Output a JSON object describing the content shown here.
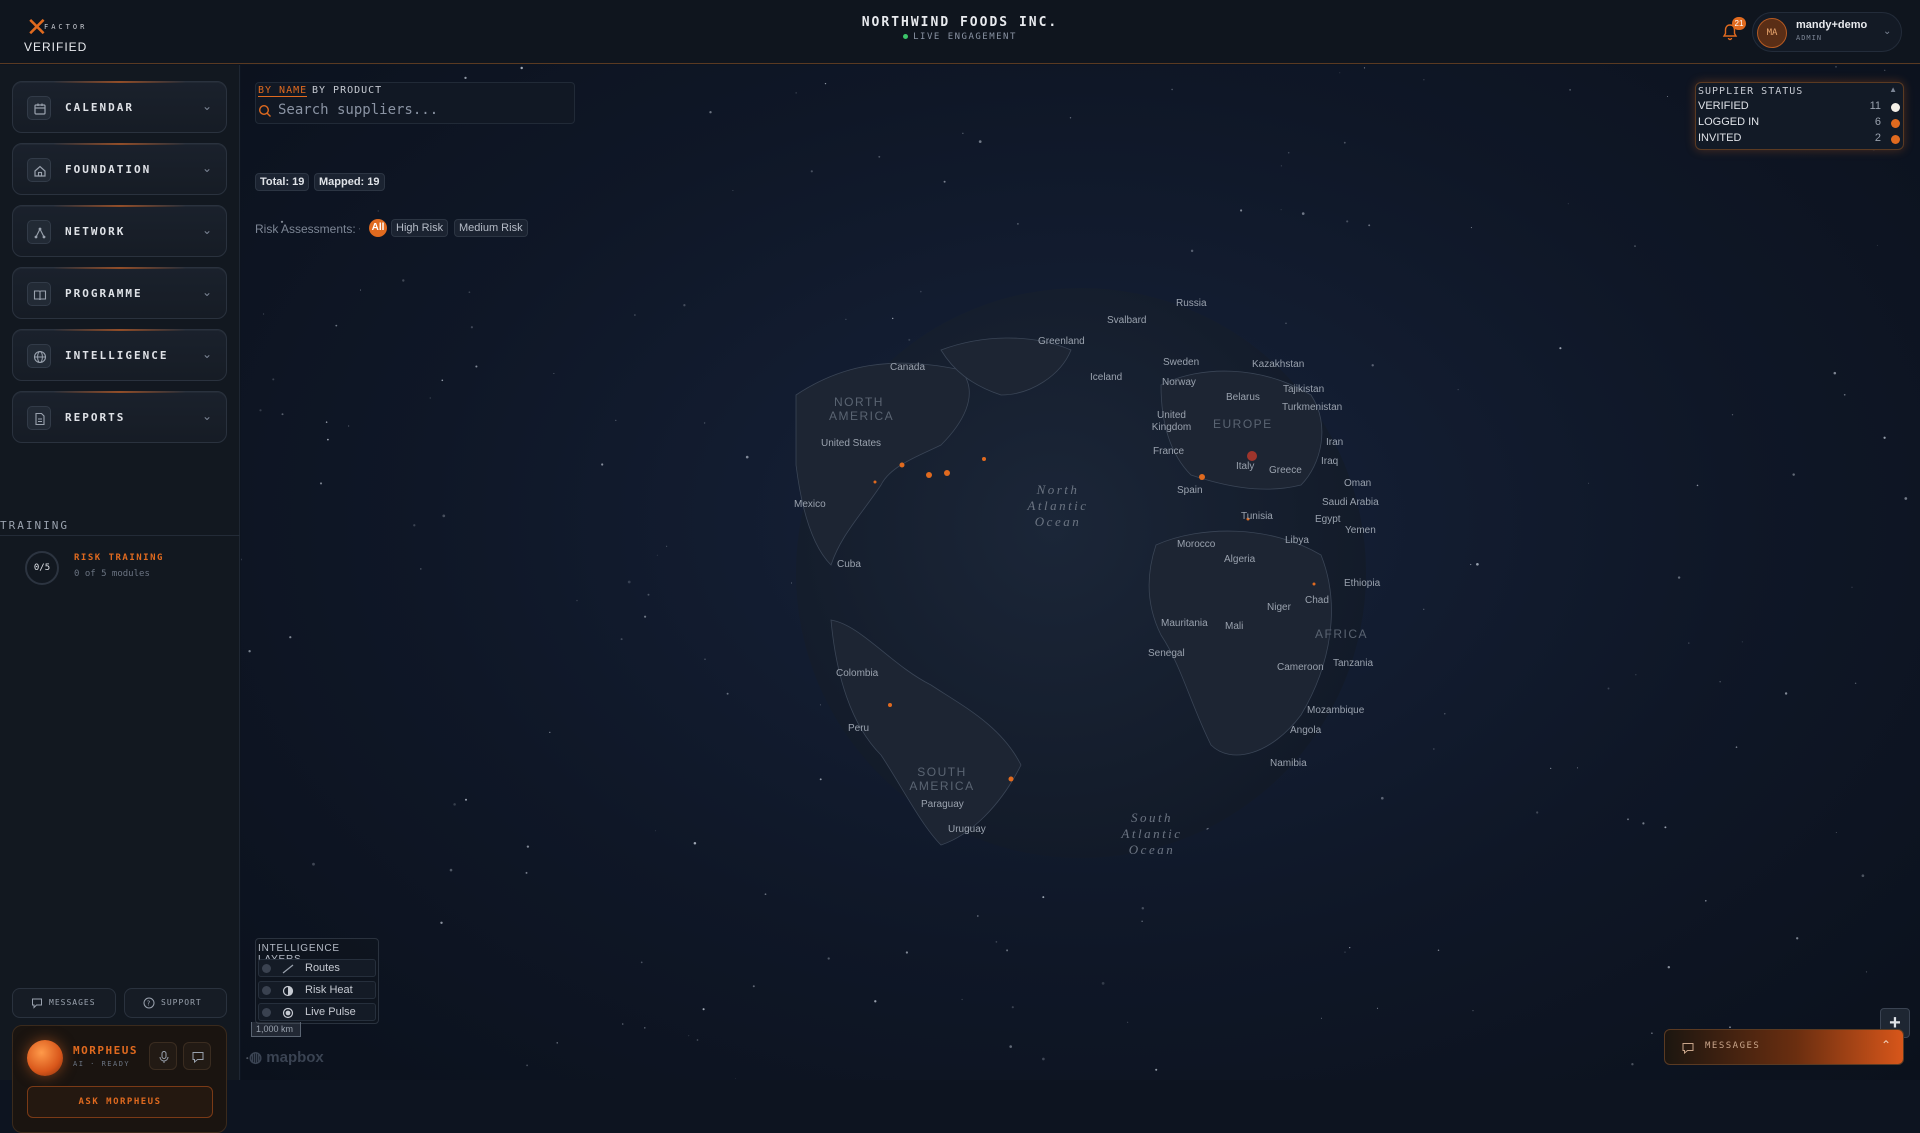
{
  "brand": {
    "logo_factor": "FACTOR",
    "logo_verified": "VERIFIED"
  },
  "header": {
    "company": "NORTHWIND FOODS INC.",
    "status": "LIVE ENGAGEMENT",
    "notifications_count": "21",
    "user": {
      "initials": "MA",
      "name": "mandy+demo",
      "role": "ADMIN"
    }
  },
  "sidebar": {
    "items": [
      {
        "label": "CALENDAR",
        "icon": "calendar-icon"
      },
      {
        "label": "FOUNDATION",
        "icon": "home-icon"
      },
      {
        "label": "NETWORK",
        "icon": "network-icon"
      },
      {
        "label": "PROGRAMME",
        "icon": "book-icon"
      },
      {
        "label": "INTELLIGENCE",
        "icon": "globe-icon"
      },
      {
        "label": "REPORTS",
        "icon": "document-icon"
      }
    ],
    "training": {
      "title": "TRAINING",
      "progress": "0/5",
      "name": "RISK TRAINING",
      "sub": "0 of 5 modules"
    },
    "footer": {
      "messages": "MESSAGES",
      "support": "SUPPORT",
      "assistant_name": "MORPHEUS",
      "assistant_status": "AI · READY",
      "ask": "ASK MORPHEUS"
    }
  },
  "search": {
    "tab_name": "BY NAME",
    "tab_product": "BY PRODUCT",
    "placeholder": "Search suppliers..."
  },
  "stats": {
    "total": "Total: 19",
    "mapped": "Mapped: 19"
  },
  "risk": {
    "label": "Risk Assessments:",
    "all": "All",
    "high": "High Risk",
    "medium": "Medium Risk"
  },
  "supplier_status": {
    "title": "SUPPLIER STATUS",
    "rows": [
      {
        "label": "VERIFIED",
        "value": "11",
        "color": "#f4f0e8"
      },
      {
        "label": "LOGGED IN",
        "value": "6",
        "color": "#e06a1f"
      },
      {
        "label": "INVITED",
        "value": "2",
        "color": "#e06a1f"
      }
    ]
  },
  "map_labels": {
    "continents": [
      "NORTH AMERICA",
      "EUROPE",
      "AFRICA",
      "SOUTH AMERICA"
    ],
    "oceans": [
      "North Atlantic Ocean",
      "South Atlantic Ocean"
    ],
    "countries": [
      "Russia",
      "Svalbard",
      "Greenland",
      "Canada",
      "Iceland",
      "Sweden",
      "Norway",
      "Kazakhstan",
      "Belarus",
      "Tajikistan",
      "Turkmenistan",
      "United Kingdom",
      "United States",
      "France",
      "Italy",
      "Greece",
      "Iran",
      "Iraq",
      "Oman",
      "Spain",
      "Mexico",
      "Tunisia",
      "Saudi Arabia",
      "Egypt",
      "Yemen",
      "Morocco",
      "Libya",
      "Algeria",
      "Cuba",
      "Ethiopia",
      "Niger",
      "Chad",
      "Mauritania",
      "Mali",
      "Senegal",
      "Cameroon",
      "Tanzania",
      "Colombia",
      "Mozambique",
      "Peru",
      "Angola",
      "Namibia",
      "Paraguay",
      "Uruguay"
    ]
  },
  "layers": {
    "title": "INTELLIGENCE LAYERS",
    "items": [
      "Routes",
      "Risk Heat",
      "Live Pulse"
    ]
  },
  "scale": "1,000 km",
  "attribution": "mapbox",
  "messages_bar": "MESSAGES"
}
